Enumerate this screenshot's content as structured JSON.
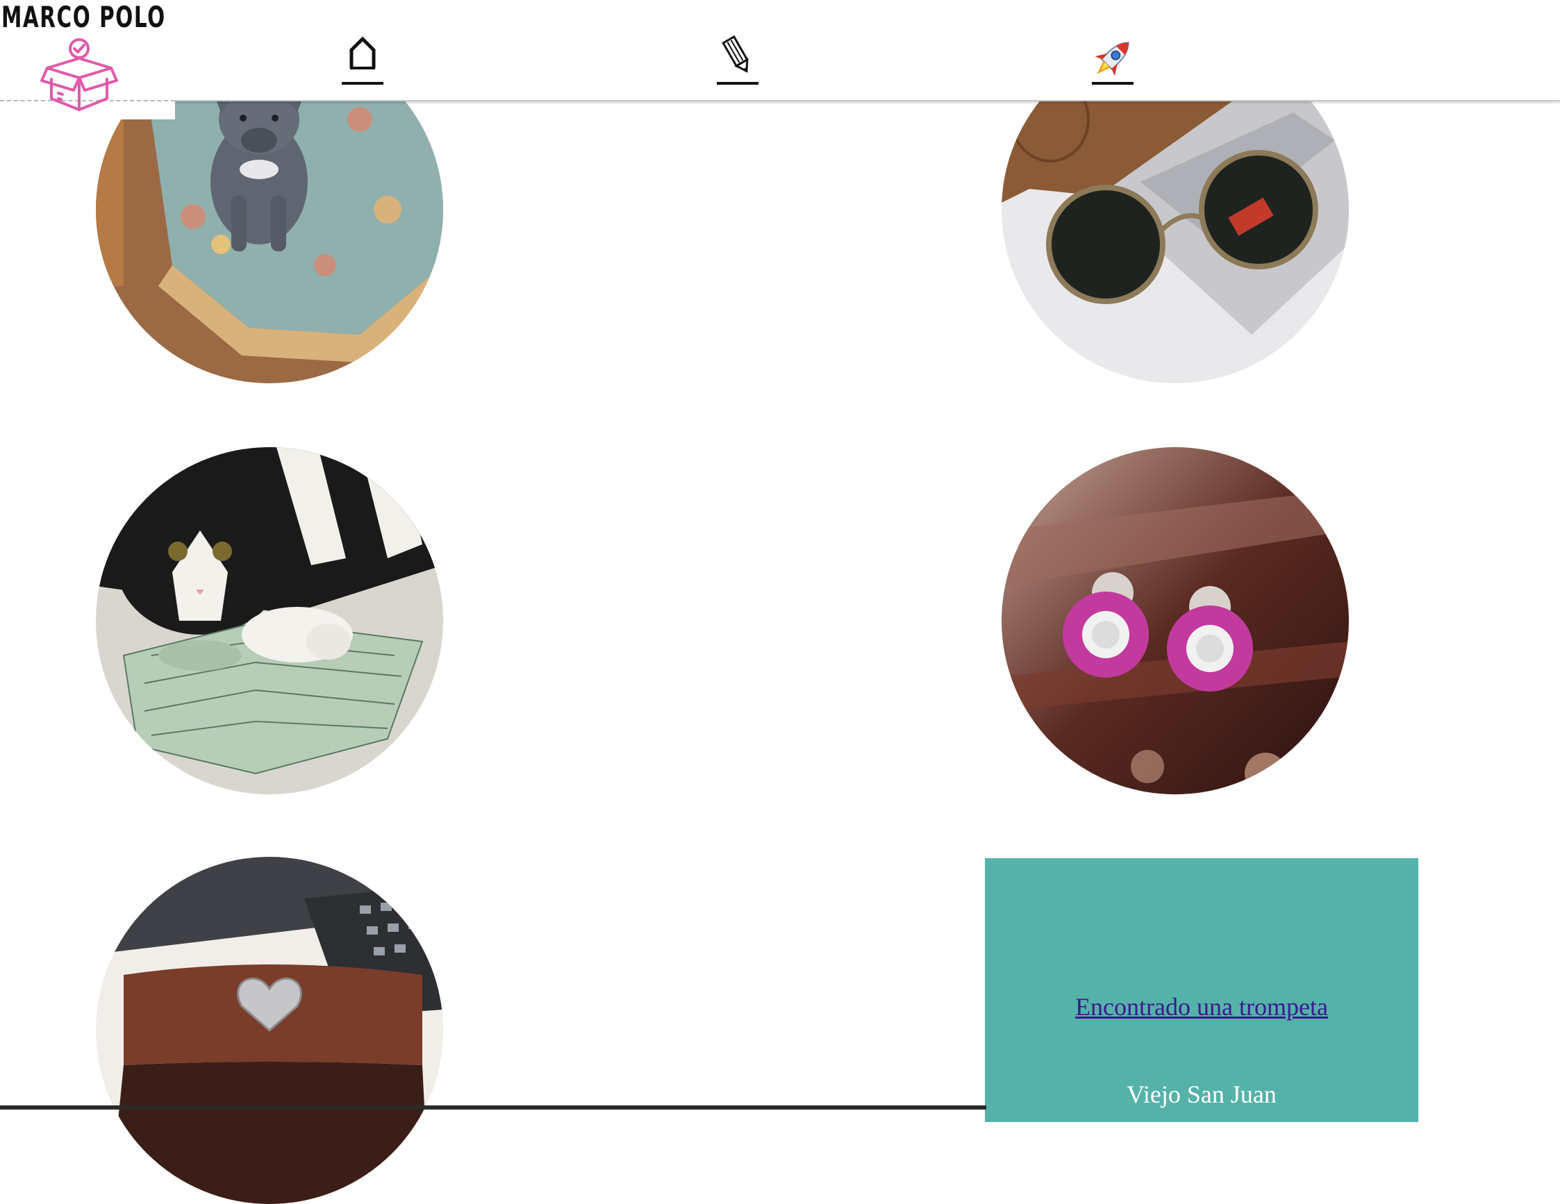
{
  "header": {
    "brand": "MARCO POLO",
    "logo_icon": "open-box-check-icon",
    "logo_color": "#e05aa8",
    "nav": [
      {
        "icon": "home-icon"
      },
      {
        "icon": "pencil-icon"
      },
      {
        "icon": "rocket-icon"
      }
    ]
  },
  "items": [
    {
      "image": "french-bulldog-puppy-on-rug"
    },
    {
      "image": "ray-ban-sunglasses-with-case"
    },
    {
      "image": "cat-on-hundred-dollar-bills"
    },
    {
      "image": "pink-flower-earrings"
    },
    {
      "image": "leather-wallet-heart-clasp"
    }
  ],
  "card": {
    "link": "Encontrado una trompeta",
    "location": "Viejo San Juan",
    "background": "#54b2a9"
  }
}
